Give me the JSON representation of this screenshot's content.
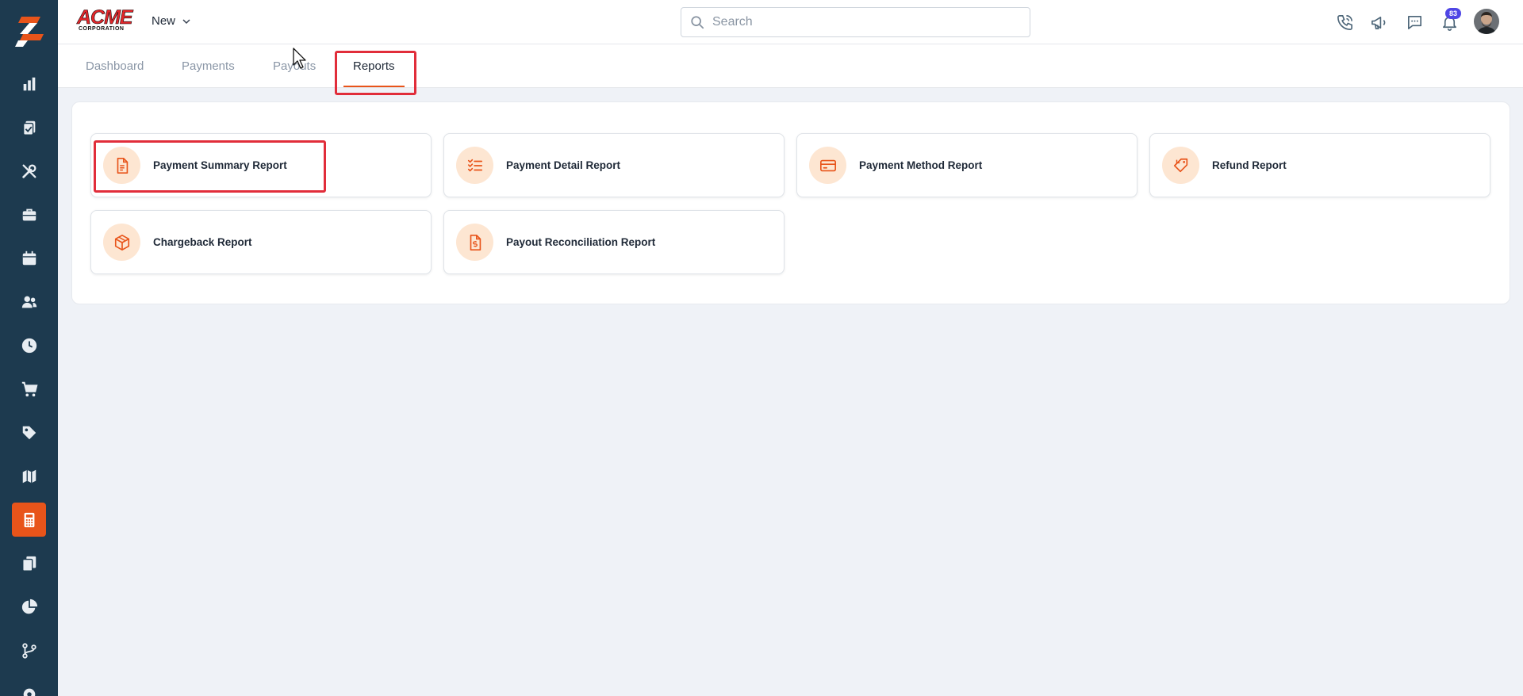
{
  "colors": {
    "sidebar_bg": "#1d3a4f",
    "accent": "#e8541a",
    "highlight_box": "#e12d3a",
    "badge": "#4f46e5"
  },
  "sidebar": {
    "logo": "app-logo-icon",
    "items": [
      {
        "icon": "bar-chart-icon",
        "active": false
      },
      {
        "icon": "clipboard-icon",
        "active": false
      },
      {
        "icon": "tools-icon",
        "active": false
      },
      {
        "icon": "briefcase-icon",
        "active": false
      },
      {
        "icon": "calendar-icon",
        "active": false
      },
      {
        "icon": "users-icon",
        "active": false
      },
      {
        "icon": "clock-icon",
        "active": false
      },
      {
        "icon": "cart-icon",
        "active": false
      },
      {
        "icon": "tag-icon",
        "active": false
      },
      {
        "icon": "map-icon",
        "active": false
      },
      {
        "icon": "calculator-icon",
        "active": true
      },
      {
        "icon": "documents-icon",
        "active": false
      },
      {
        "icon": "pie-chart-icon",
        "active": false
      },
      {
        "icon": "branch-icon",
        "active": false
      },
      {
        "icon": "settings-icon",
        "active": false
      }
    ]
  },
  "header": {
    "logo_text": "ACME",
    "logo_subtext": "CORPORATION",
    "new_label": "New",
    "search": {
      "placeholder": "Search",
      "value": ""
    },
    "icons": [
      "phone-icon",
      "megaphone-icon",
      "chat-icon",
      "bell-icon"
    ],
    "notification_count": "83"
  },
  "tabs": [
    {
      "label": "Dashboard",
      "active": false
    },
    {
      "label": "Payments",
      "active": false
    },
    {
      "label": "Payouts",
      "active": false
    },
    {
      "label": "Reports",
      "active": true
    }
  ],
  "reports": [
    {
      "label": "Payment Summary Report",
      "icon": "document-icon"
    },
    {
      "label": "Payment Detail Report",
      "icon": "checklist-icon"
    },
    {
      "label": "Payment Method Report",
      "icon": "credit-card-icon"
    },
    {
      "label": "Refund Report",
      "icon": "tag-icon"
    },
    {
      "label": "Chargeback Report",
      "icon": "box-icon"
    },
    {
      "label": "Payout Reconciliation Report",
      "icon": "dollar-file-icon"
    }
  ]
}
